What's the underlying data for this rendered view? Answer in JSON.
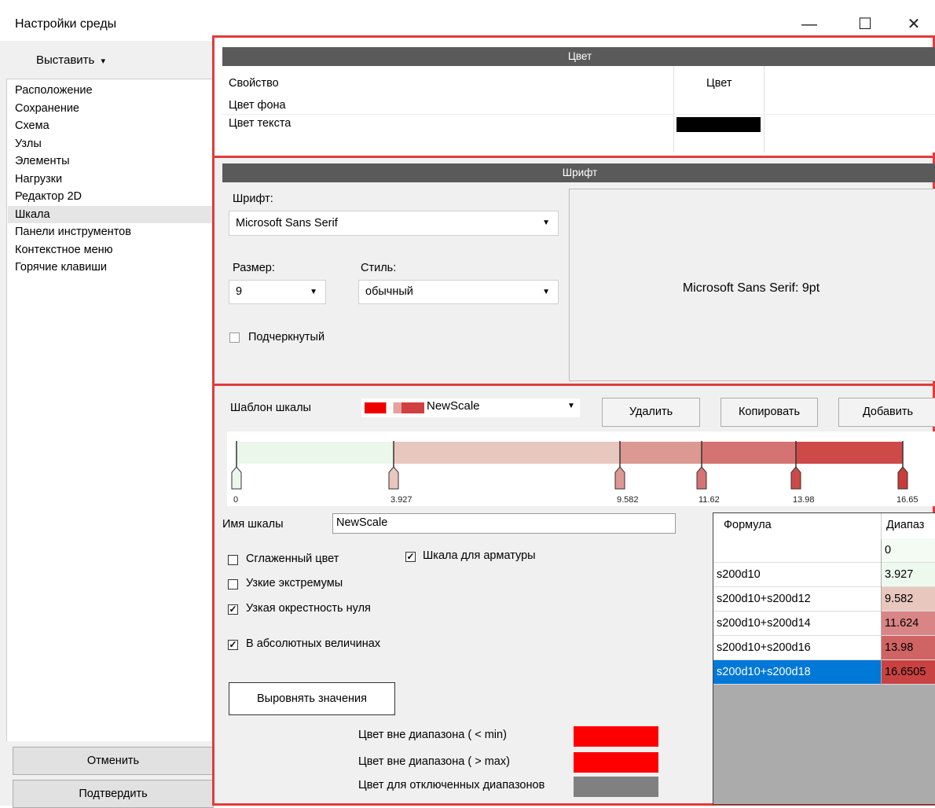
{
  "window": {
    "title": "Настройки среды",
    "minimize": "—",
    "maximize": "☐",
    "close": "✕"
  },
  "left": {
    "dropdown_label": "Выставить",
    "dropdown_arrow": "▾",
    "nav": [
      "Расположение",
      "Сохранение",
      "Схема",
      "Узлы",
      "Элементы",
      "Нагрузки",
      "Редактор 2D",
      "Шкала",
      "Панели инструментов",
      "Контекстное меню",
      "Горячие клавиши"
    ],
    "selected_index": 7,
    "cancel": "Отменить",
    "confirm": "Подтвердить"
  },
  "color_section": {
    "header": "Цвет",
    "col_property": "Свойство",
    "col_color": "Цвет",
    "rows": [
      {
        "name": "Цвет фона",
        "swatch": ""
      },
      {
        "name": "Цвет текста",
        "swatch": "#000000"
      }
    ]
  },
  "font_section": {
    "header": "Шрифт",
    "font_label": "Шрифт:",
    "font_value": "Microsoft Sans Serif",
    "size_label": "Размер:",
    "size_value": "9",
    "style_label": "Стиль:",
    "style_value": "обычный",
    "underline_label": "Подчеркнутый",
    "underline_checked": false,
    "preview": "Microsoft Sans Serif: 9pt"
  },
  "scale_section": {
    "template_label": "Шаблон шкалы",
    "template_value": "NewScale",
    "delete": "Удалить",
    "copy": "Копировать",
    "add": "Добавить",
    "gradient": {
      "stops": [
        {
          "label": "0",
          "value": 0,
          "color": "#eaf7ea"
        },
        {
          "label": "3.927",
          "value": 3.927,
          "color": "#e8c7be"
        },
        {
          "label": "9.582",
          "value": 9.582,
          "color": "#dc9893"
        },
        {
          "label": "11.62",
          "value": 11.624,
          "color": "#d47372"
        },
        {
          "label": "13.98",
          "value": 13.98,
          "color": "#ce4a48"
        },
        {
          "label": "16.65",
          "value": 16.6505,
          "color": "#c83c3c"
        }
      ]
    },
    "name_label": "Имя шкалы",
    "name_value": "NewScale",
    "checkboxes": [
      {
        "label": "Сглаженный цвет",
        "checked": false
      },
      {
        "label": "Узкие экстремумы",
        "checked": false
      },
      {
        "label": "Узкая окрестность нуля",
        "checked": true
      },
      {
        "label": "В абсолютных величинах",
        "checked": true
      }
    ],
    "rebar_label": "Шкала для арматуры",
    "rebar_checked": true,
    "align_button": "Выровнять значения",
    "out_min_label": "Цвет вне диапазона ( < min)",
    "out_max_label": "Цвет вне диапазона ( > max)",
    "disabled_label": "Цвет для отключенных диапазонов",
    "out_min_color": "#ff0000",
    "out_max_color": "#ff0000",
    "disabled_color": "#808080",
    "table": {
      "col_formula": "Формула",
      "col_range": "Диапаз",
      "rows": [
        {
          "formula": "",
          "value": "0",
          "color": "#f3fbf3"
        },
        {
          "formula": "s200d10",
          "value": "3.927",
          "color": "#eef9ee"
        },
        {
          "formula": "s200d10+s200d12",
          "value": "9.582",
          "color": "#e8c7be"
        },
        {
          "formula": "s200d10+s200d14",
          "value": "11.624",
          "color": "#da8585"
        },
        {
          "formula": "s200d10+s200d16",
          "value": "13.98",
          "color": "#d06464"
        },
        {
          "formula": "s200d10+s200d18",
          "value": "16.6505",
          "color": "#c84242"
        }
      ],
      "selected_index": 5
    }
  }
}
